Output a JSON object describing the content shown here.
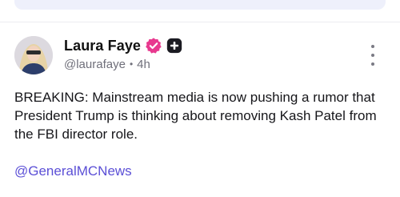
{
  "post": {
    "author": {
      "display_name": "Laura Faye",
      "handle": "@laurafaye",
      "time_ago": "4h",
      "separator": "•",
      "verified_badge_icon": "verified-check-icon",
      "plus_badge_icon": "plus-badge-icon"
    },
    "body": "BREAKING: Mainstream media is now pushing a rumor that President Trump is thinking about removing Kash Patel from the FBI director role.",
    "link_handle": "@GeneralMCNews",
    "menu_icon": "more-vertical-icon"
  },
  "colors": {
    "verified_pink": "#e8398f",
    "link_purple": "#5b4fd6",
    "muted_text": "#6f6f7a",
    "top_pill": "#eef0fb"
  }
}
